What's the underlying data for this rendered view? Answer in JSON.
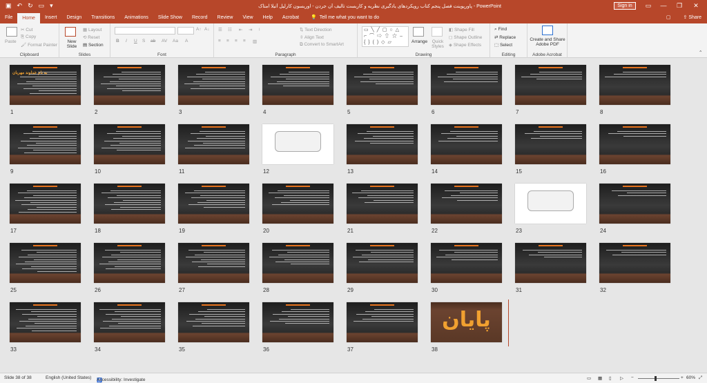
{
  "window": {
    "title": "پاورپوینت فصل پنجم کتاب رویکردهای یادگیری نظریه و کاربست تالیف آن جردن - اوریسون کارلیل آتیلا امتاک - PowerPoint",
    "signin_label": "Sign in"
  },
  "tabs": [
    "File",
    "Home",
    "Insert",
    "Design",
    "Transitions",
    "Animations",
    "Slide Show",
    "Record",
    "Review",
    "View",
    "Help",
    "Acrobat"
  ],
  "active_tab": "Home",
  "tell_me": "Tell me what you want to do",
  "share_label": "Share",
  "ribbon": {
    "clipboard": {
      "paste": "Paste",
      "cut": "Cut",
      "copy": "Copy",
      "format_painter": "Format Painter",
      "label": "Clipboard"
    },
    "slides": {
      "new_slide": "New Slide",
      "layout": "Layout",
      "reset": "Reset",
      "section": "Section",
      "label": "Slides"
    },
    "font": {
      "label": "Font"
    },
    "paragraph": {
      "text_direction": "Text Direction",
      "align_text": "Align Text",
      "smartart": "Convert to SmartArt",
      "label": "Paragraph"
    },
    "drawing": {
      "arrange": "Arrange",
      "quick_styles": "Quick Styles",
      "shape_fill": "Shape Fill",
      "shape_outline": "Shape Outline",
      "shape_effects": "Shape Effects",
      "label": "Drawing"
    },
    "editing": {
      "find": "Find",
      "replace": "Replace",
      "select": "Select",
      "label": "Editing"
    },
    "acrobat": {
      "create_share": "Create and Share Adobe PDF",
      "label": "Adobe Acrobat"
    }
  },
  "slides": {
    "count": 38,
    "numbers": [
      "1",
      "2",
      "3",
      "4",
      "5",
      "6",
      "7",
      "8",
      "9",
      "10",
      "11",
      "12",
      "13",
      "14",
      "15",
      "16",
      "17",
      "18",
      "19",
      "20",
      "21",
      "22",
      "23",
      "24",
      "25",
      "26",
      "27",
      "28",
      "29",
      "30",
      "31",
      "32",
      "33",
      "34",
      "35",
      "36",
      "37",
      "38"
    ],
    "final_slide_text": "پایان",
    "first_slide_title": "به نام خداوند مهربان"
  },
  "status": {
    "slide_indicator": "Slide 38 of 38",
    "language": "English (United States)",
    "accessibility": "Accessibility: Investigate",
    "zoom": "60%"
  }
}
